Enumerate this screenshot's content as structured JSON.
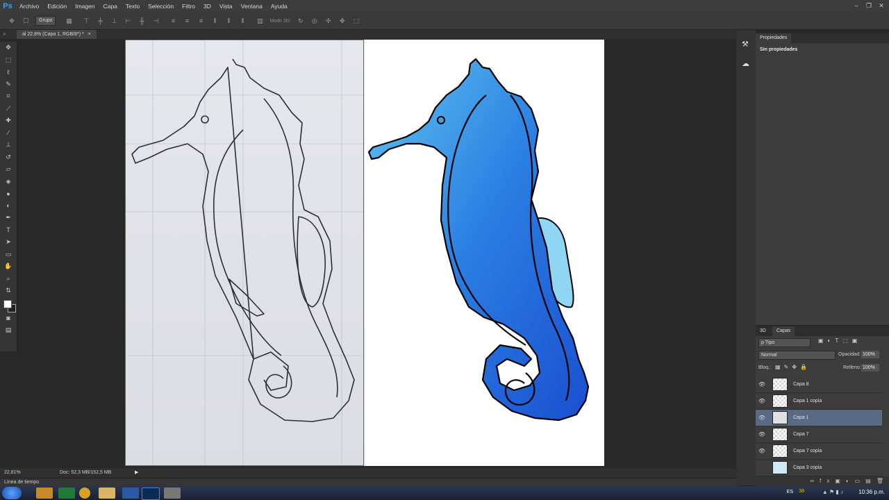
{
  "app": {
    "logo": "Ps"
  },
  "menu": [
    "Archivo",
    "Edición",
    "Imagen",
    "Capa",
    "Texto",
    "Selección",
    "Filtro",
    "3D",
    "Vista",
    "Ventana",
    "Ayuda"
  ],
  "window_controls": [
    "–",
    "❐",
    "✕"
  ],
  "options_bar": {
    "auto_select": "Grupo",
    "mode_3d": "Modo 3D:"
  },
  "document_tab": {
    "title": "al 22,8% (Capa 1, RGB/8*) *",
    "close": "×"
  },
  "status": {
    "zoom": "22,81%",
    "doc": "Doc: 52,3 MB/152,5 MB"
  },
  "timeline": {
    "label": "Línea de tiempo"
  },
  "properties": {
    "tab": "Propiedades",
    "content": "Sin propiedades"
  },
  "layers_panel": {
    "tabs": [
      "3D",
      "Capas"
    ],
    "filter": "ρ Tipo",
    "blend_mode": "Normal",
    "opacity_label": "Opacidad:",
    "opacity_value": "100%",
    "lock_label": "Bloq.:",
    "fill_label": "Relleno:",
    "fill_value": "100%",
    "layers": [
      {
        "name": "Capa 8",
        "visible": true,
        "selected": false
      },
      {
        "name": "Capa 1 copia",
        "visible": true,
        "selected": false
      },
      {
        "name": "Capa 1",
        "visible": true,
        "selected": true
      },
      {
        "name": "Capa 7",
        "visible": true,
        "selected": false
      },
      {
        "name": "Capa 7 copia",
        "visible": true,
        "selected": false
      },
      {
        "name": "Capa 3 copia",
        "visible": false,
        "selected": false
      }
    ]
  },
  "taskbar": {
    "lang": "ES",
    "badge": "38",
    "clock": "10:36 p.m."
  },
  "colors": {
    "accent": "#3fa0e8",
    "selected_layer": "#596a84",
    "seahorse_blue": "#2a7de1"
  }
}
